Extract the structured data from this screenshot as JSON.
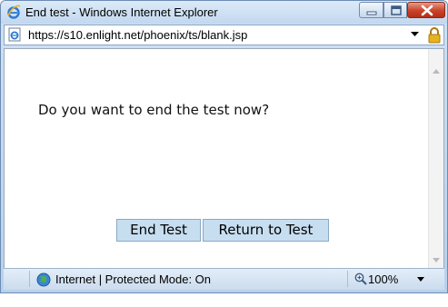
{
  "window": {
    "title": "End test - Windows Internet Explorer"
  },
  "address_bar": {
    "url": "https://s10.enlight.net/phoenix/ts/blank.jsp"
  },
  "dialog": {
    "prompt": "Do you want to end the test now?",
    "end_button_label": "End Test",
    "return_button_label": "Return to Test"
  },
  "status_bar": {
    "zone_text": "Internet | Protected Mode: On",
    "zoom_text": "100%"
  },
  "icons": [
    "ie-logo-icon",
    "minimize-icon",
    "maximize-icon",
    "close-icon",
    "page-icon",
    "dropdown-arrow-icon",
    "lock-icon",
    "scroll-up-arrow-icon",
    "scroll-down-arrow-icon",
    "globe-icon",
    "zoom-icon"
  ],
  "colors": {
    "button_bg": "#c7def1",
    "close_button": "#c8432a",
    "chrome_blue": "#c2d8ef"
  }
}
